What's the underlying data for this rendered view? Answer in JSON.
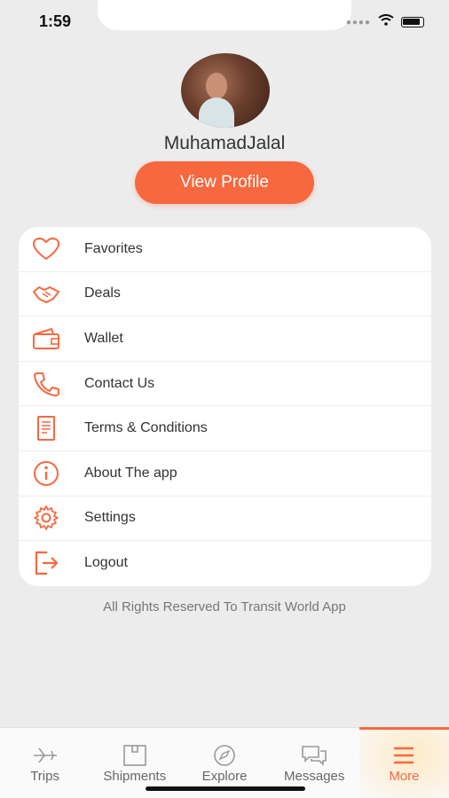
{
  "status_bar": {
    "time": "1:59"
  },
  "profile": {
    "name": "MuhamadJalal",
    "view_profile_label": "View Profile"
  },
  "menu": {
    "items": [
      {
        "label": "Favorites",
        "icon": "heart-icon"
      },
      {
        "label": "Deals",
        "icon": "handshake-icon"
      },
      {
        "label": "Wallet",
        "icon": "wallet-icon"
      },
      {
        "label": "Contact Us",
        "icon": "phone-icon"
      },
      {
        "label": "Terms & Conditions",
        "icon": "document-icon"
      },
      {
        "label": "About The app",
        "icon": "info-icon"
      },
      {
        "label": "Settings",
        "icon": "gear-icon"
      },
      {
        "label": "Logout",
        "icon": "logout-icon"
      }
    ]
  },
  "footer": {
    "text": "All Rights Reserved To Transit World App"
  },
  "tabs": [
    {
      "label": "Trips",
      "icon": "plane-icon",
      "active": false
    },
    {
      "label": "Shipments",
      "icon": "box-icon",
      "active": false
    },
    {
      "label": "Explore",
      "icon": "compass-icon",
      "active": false
    },
    {
      "label": "Messages",
      "icon": "chat-icon",
      "active": false
    },
    {
      "label": "More",
      "icon": "menu-icon",
      "active": true
    }
  ],
  "colors": {
    "accent": "#f7683f",
    "background": "#ececec"
  }
}
